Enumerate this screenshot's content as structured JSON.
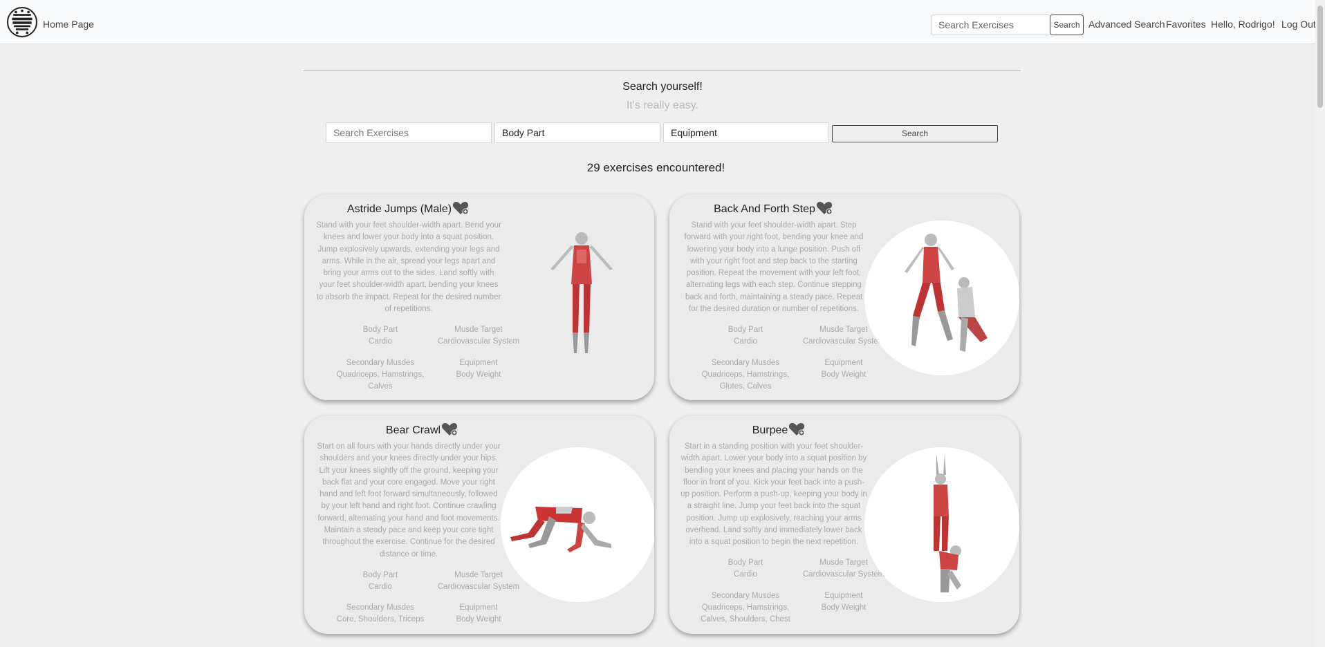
{
  "nav": {
    "logo_name": "logo-icon",
    "home": "Home Page",
    "search_placeholder": "Search Exercises",
    "search_button": "Search",
    "advanced": "Advanced Search",
    "favorites": "Favorites",
    "greeting": "Hello, Rodrigo!",
    "logout": "Log Out"
  },
  "hero": {
    "title": "Search yourself!",
    "subtitle": "It's really easy.",
    "search_placeholder": "Search Exercises",
    "body_part": "Body Part",
    "equipment": "Equipment",
    "search_button": "Search",
    "count": "29 exercises encountered!"
  },
  "labels": {
    "body_part": "Body Part",
    "muscle_target": "Musde Target",
    "secondary": "Secondary Musdes",
    "equipment": "Equipment"
  },
  "cards": [
    {
      "name": "Astride Jumps (Male)",
      "description": "Stand with your feet shoulder-width apart. Bend your knees and lower your body into a squat position. Jump explosively upwards, extending your legs and arms. While in the air, spread your legs apart and bring your arms out to the sides. Land softly with your feet shoulder-width apart, bending your knees to absorb the impact. Repeat for the desired number of repetitions.",
      "body_part": "Cardio",
      "target": "Cardiovascular System",
      "secondary": "Quadriceps, Hamstrings, Calves",
      "equipment": "Body Weight"
    },
    {
      "name": "Back And Forth Step",
      "description": "Stand with your feet shoulder-width apart. Step forward with your right foot, bending your knee and lowering your body into a lunge position. Push off with your right foot and step back to the starting position. Repeat the movement with your left foot, alternating legs with each step. Continue stepping back and forth, maintaining a steady pace. Repeat for the desired duration or number of repetitions.",
      "body_part": "Cardio",
      "target": "Cardiovascular System",
      "secondary": "Quadriceps, Hamstrings, Glutes, Calves",
      "equipment": "Body Weight"
    },
    {
      "name": "Bear Crawl",
      "description": "Start on all fours with your hands directly under your shoulders and your knees directly under your hips. Lift your knees slightly off the ground, keeping your back flat and your core engaged. Move your right hand and left foot forward simultaneously, followed by your left hand and right foot. Continue crawling forward, alternating your hand and foot movements. Maintain a steady pace and keep your core tight throughout the exercise. Continue for the desired distance or time.",
      "body_part": "Cardio",
      "target": "Cardiovascular System",
      "secondary": "Core, Shoulders, Triceps",
      "equipment": "Body Weight"
    },
    {
      "name": "Burpee",
      "description": "Start in a standing position with your feet shoulder-width apart. Lower your body into a squat position by bending your knees and placing your hands on the floor in front of you. Kick your feet back into a push-up position. Perform a push-up, keeping your body in a straight line. Jump your feet back into the squat position. Jump up explosively, reaching your arms overhead. Land softly and immediately lower back into a squat position to begin the next repetition.",
      "body_part": "Cardio",
      "target": "Cardiovascular System",
      "secondary": "Quadriceps, Hamstrings, Calves, Shoulders, Chest",
      "equipment": "Body Weight"
    }
  ]
}
